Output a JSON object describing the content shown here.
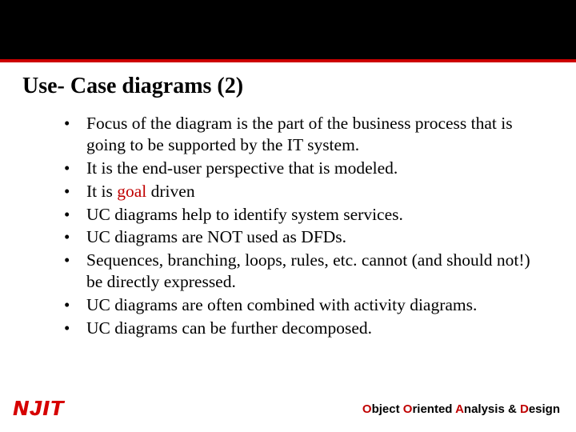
{
  "title": "Use- Case diagrams (2)",
  "bullets": [
    {
      "pre": "Focus of the diagram is the part of the business process that is going to be supported by the IT system.",
      "em": "",
      "post": ""
    },
    {
      "pre": "It is the end-user perspective that is modeled.",
      "em": "",
      "post": ""
    },
    {
      "pre": "It is ",
      "em": "goal",
      "post": " driven"
    },
    {
      "pre": "UC diagrams help to identify system services.",
      "em": "",
      "post": ""
    },
    {
      "pre": "UC diagrams are NOT used as DFDs.",
      "em": "",
      "post": ""
    },
    {
      "pre": "Sequences, branching, loops, rules, etc. cannot (and should not!) be directly expressed.",
      "em": "",
      "post": ""
    },
    {
      "pre": "UC diagrams are often combined with activity diagrams.",
      "em": "",
      "post": ""
    },
    {
      "pre": "UC diagrams can be further decomposed.",
      "em": "",
      "post": ""
    }
  ],
  "logo": "NJIT",
  "footer": {
    "o": "O",
    "word1a": "bject ",
    "word2a": "riented ",
    "a": "A",
    "word3a": "nalysis & ",
    "d": "D",
    "word4a": "esign"
  }
}
